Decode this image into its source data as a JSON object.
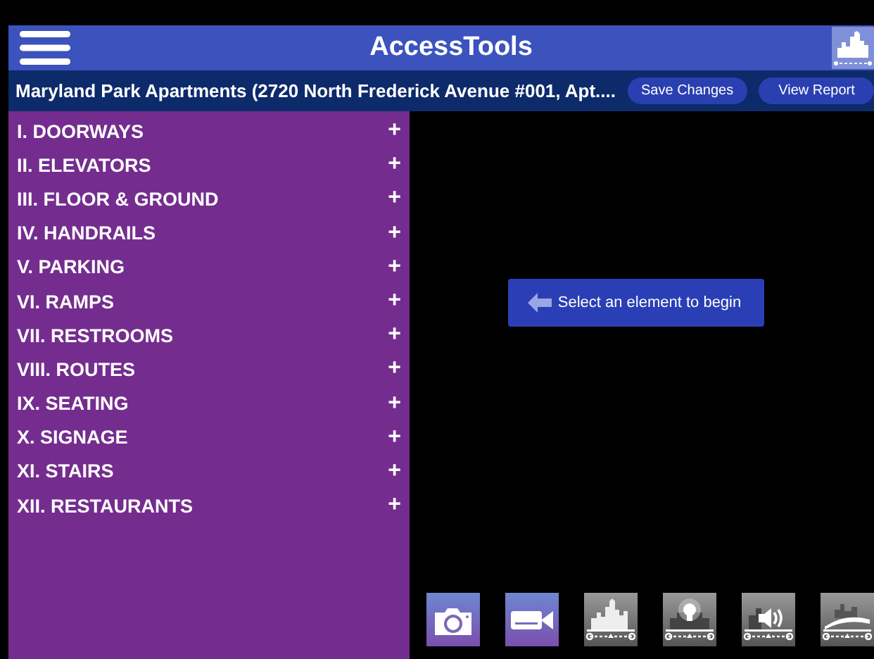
{
  "header": {
    "title": "AccessTools"
  },
  "location_bar": {
    "title": "Maryland Park Apartments (2720 North Frederick Avenue #001, Apt....",
    "buttons": [
      "Save Changes",
      "View Report"
    ]
  },
  "sidebar": {
    "items": [
      {
        "label": "I. DOORWAYS",
        "expander": "+"
      },
      {
        "label": "II. ELEVATORS",
        "expander": "+"
      },
      {
        "label": "III. FLOOR & GROUND",
        "expander": "+"
      },
      {
        "label": "IV. HANDRAILS",
        "expander": "+"
      },
      {
        "label": "V. PARKING",
        "expander": "+"
      },
      {
        "label": "VI. RAMPS",
        "expander": "+"
      },
      {
        "label": "VII. RESTROOMS",
        "expander": "+"
      },
      {
        "label": "VIII. ROUTES",
        "expander": "+"
      },
      {
        "label": "IX. SEATING",
        "expander": "+"
      },
      {
        "label": "X. SIGNAGE",
        "expander": "+"
      },
      {
        "label": "XI. STAIRS",
        "expander": "+"
      },
      {
        "label": "XII. RESTAURANTS",
        "expander": "+"
      }
    ]
  },
  "content": {
    "prompt_button": "Select an element to begin"
  },
  "toolbar": [
    {
      "kind": "camera"
    },
    {
      "kind": "video"
    },
    {
      "kind": "skyline"
    },
    {
      "kind": "light"
    },
    {
      "kind": "sound"
    },
    {
      "kind": "road"
    }
  ]
}
